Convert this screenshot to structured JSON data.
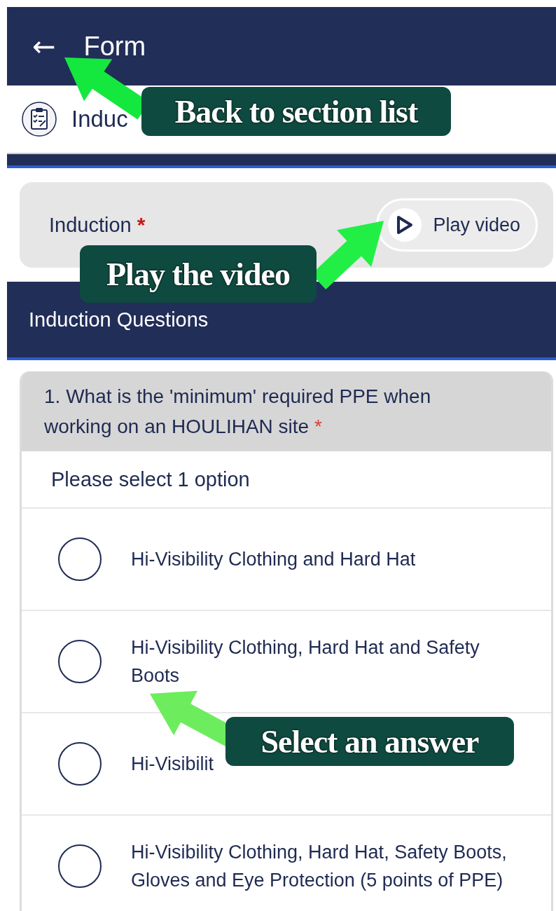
{
  "app_bar": {
    "back": "←",
    "title": "Form"
  },
  "section": {
    "label": "Induc"
  },
  "video_card": {
    "label": "Induction",
    "required_mark": "*",
    "button": "Play video"
  },
  "section_band": {
    "title": "Induction Questions"
  },
  "question": {
    "text": "1. What is the 'minimum' required PPE when working on an HOULIHAN site",
    "required_mark": "*",
    "hint": "Please select 1 option",
    "options": [
      {
        "label": "Hi-Visibility Clothing and Hard Hat",
        "selected": false
      },
      {
        "label": "Hi-Visibility Clothing, Hard Hat and Safety Boots",
        "selected": false
      },
      {
        "label": "Hi-Visibilit",
        "selected": false
      },
      {
        "label": "Hi-Visibility Clothing, Hard Hat, Safety Boots, Gloves and Eye Protection (5 points of PPE)",
        "selected": false
      }
    ]
  },
  "annotations": [
    {
      "text": "Back to section list"
    },
    {
      "text": "Play the video"
    },
    {
      "text": "Select an answer"
    }
  ]
}
